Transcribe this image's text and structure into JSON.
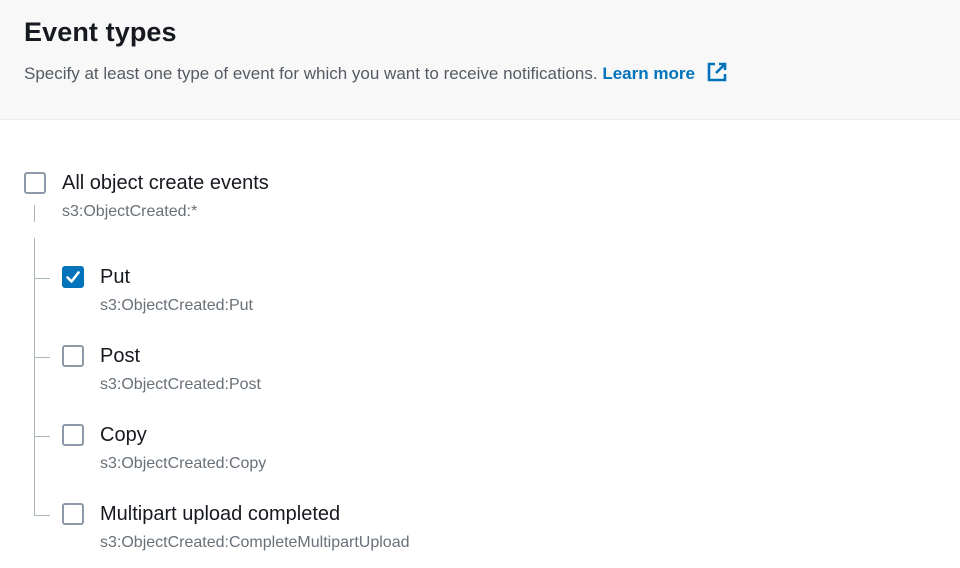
{
  "header": {
    "title": "Event types",
    "description": "Specify at least one type of event for which you want to receive notifications.",
    "learn_more": "Learn more",
    "learn_more_icon": "external-link-icon"
  },
  "colors": {
    "accent": "#0073bb",
    "header_bg": "#f8f8f8",
    "secondary_text": "#687078"
  },
  "all_create": {
    "label": "All object create events",
    "event": "s3:ObjectCreated:*",
    "checked": false
  },
  "events": [
    {
      "label": "Put",
      "event": "s3:ObjectCreated:Put",
      "checked": true
    },
    {
      "label": "Post",
      "event": "s3:ObjectCreated:Post",
      "checked": false
    },
    {
      "label": "Copy",
      "event": "s3:ObjectCreated:Copy",
      "checked": false
    },
    {
      "label": "Multipart upload completed",
      "event": "s3:ObjectCreated:CompleteMultipartUpload",
      "checked": false
    }
  ]
}
